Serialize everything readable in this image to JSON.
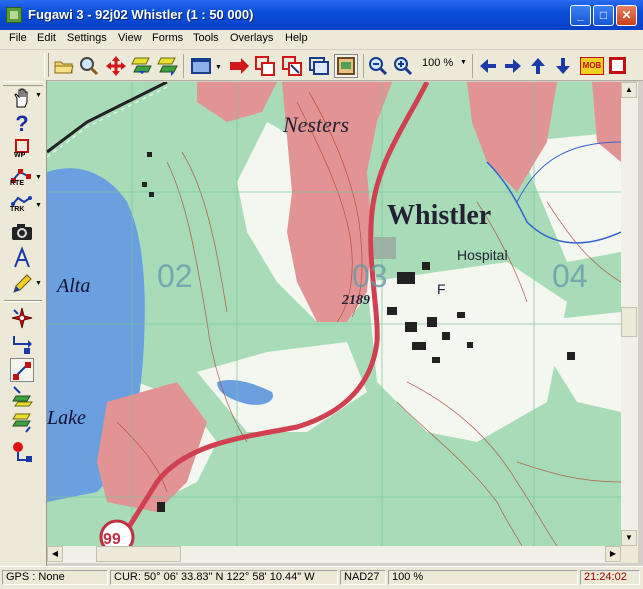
{
  "window": {
    "title": "Fugawi 3 - 92j02  Whistler  (1 : 50 000)",
    "minimize": "_",
    "maximize": "□",
    "close": "✕"
  },
  "menu": [
    "File",
    "Edit",
    "Settings",
    "View",
    "Forms",
    "Tools",
    "Overlays",
    "Help"
  ],
  "toolbar": {
    "zoom_level": "100 %",
    "mob_label": "MOB",
    "icons": [
      "open-folder-icon",
      "find-icon",
      "move-icon",
      "waypoint-list-icon",
      "route-list-icon",
      "map-window-icon",
      "goto-icon",
      "select-area-icon",
      "delete-area-icon",
      "redraw-icon",
      "view-map-icon",
      "zoom-out-icon",
      "zoom-in-icon",
      "arrow-left-icon",
      "arrow-right-icon",
      "arrow-up-icon",
      "arrow-down-icon",
      "mob-icon",
      "stop-icon"
    ]
  },
  "left_tools": {
    "wp_label": "WP",
    "rte_label": "RTE",
    "trk_label": "TRK",
    "icons": [
      "hand-icon",
      "help-icon",
      "waypoint-icon",
      "route-icon",
      "track-icon",
      "camera-icon",
      "text-icon",
      "pencil-icon",
      "compass-icon",
      "route-edit-icon",
      "route-reverse-icon",
      "waypoint-transfer-icon",
      "track-transfer-icon",
      "gps-icon"
    ]
  },
  "map": {
    "labels": {
      "nesters": "Nesters",
      "whistler": "Whistler",
      "hospital": "Hospital",
      "alta": "Alta",
      "lake": "Lake",
      "elevation": "2189",
      "grid_02": "02",
      "grid_03": "03",
      "grid_04": "04",
      "highway": "99",
      "f": "F"
    }
  },
  "status": {
    "gps": "GPS : None",
    "cursor": "CUR: 50° 06' 33.83\" N 122° 58' 10.44\" W",
    "datum": "NAD27",
    "zoom": "100 %",
    "time": "21:24:02"
  },
  "colors": {
    "title_bar": "#0a4fd8",
    "map_green": "#a8dcb8",
    "map_red": "#e08a8a",
    "water": "#6aa0e0",
    "time_red": "#a00000"
  }
}
